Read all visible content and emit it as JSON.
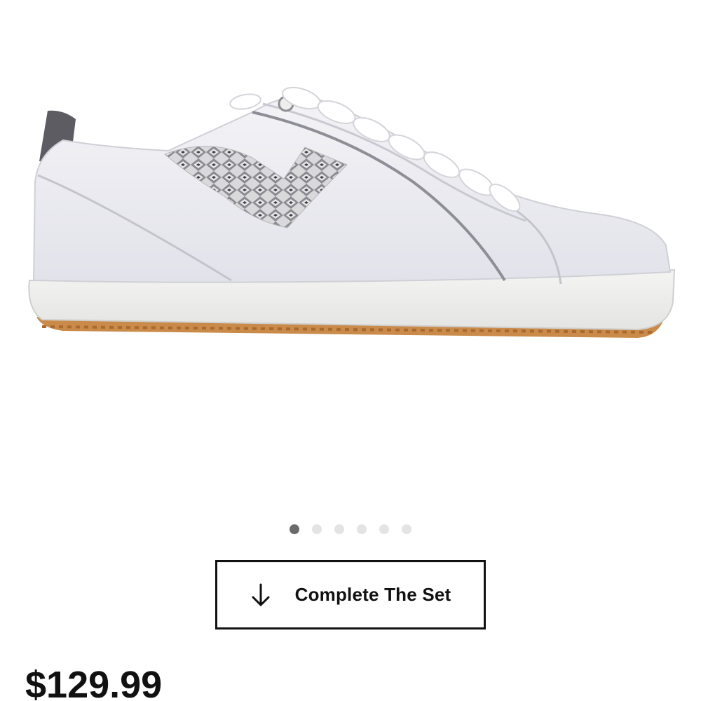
{
  "product": {
    "image_icon": "golf-shoe-image",
    "carousel": {
      "total": 6,
      "active_index": 0
    },
    "complete_set": {
      "label": "Complete The Set",
      "icon": "arrow-down-icon"
    },
    "price": "$129.99"
  },
  "colors": {
    "text": "#111111",
    "dot_active": "#6a6a6a",
    "dot_inactive": "#e4e4e4",
    "sole_gum": "#c98a4a"
  }
}
